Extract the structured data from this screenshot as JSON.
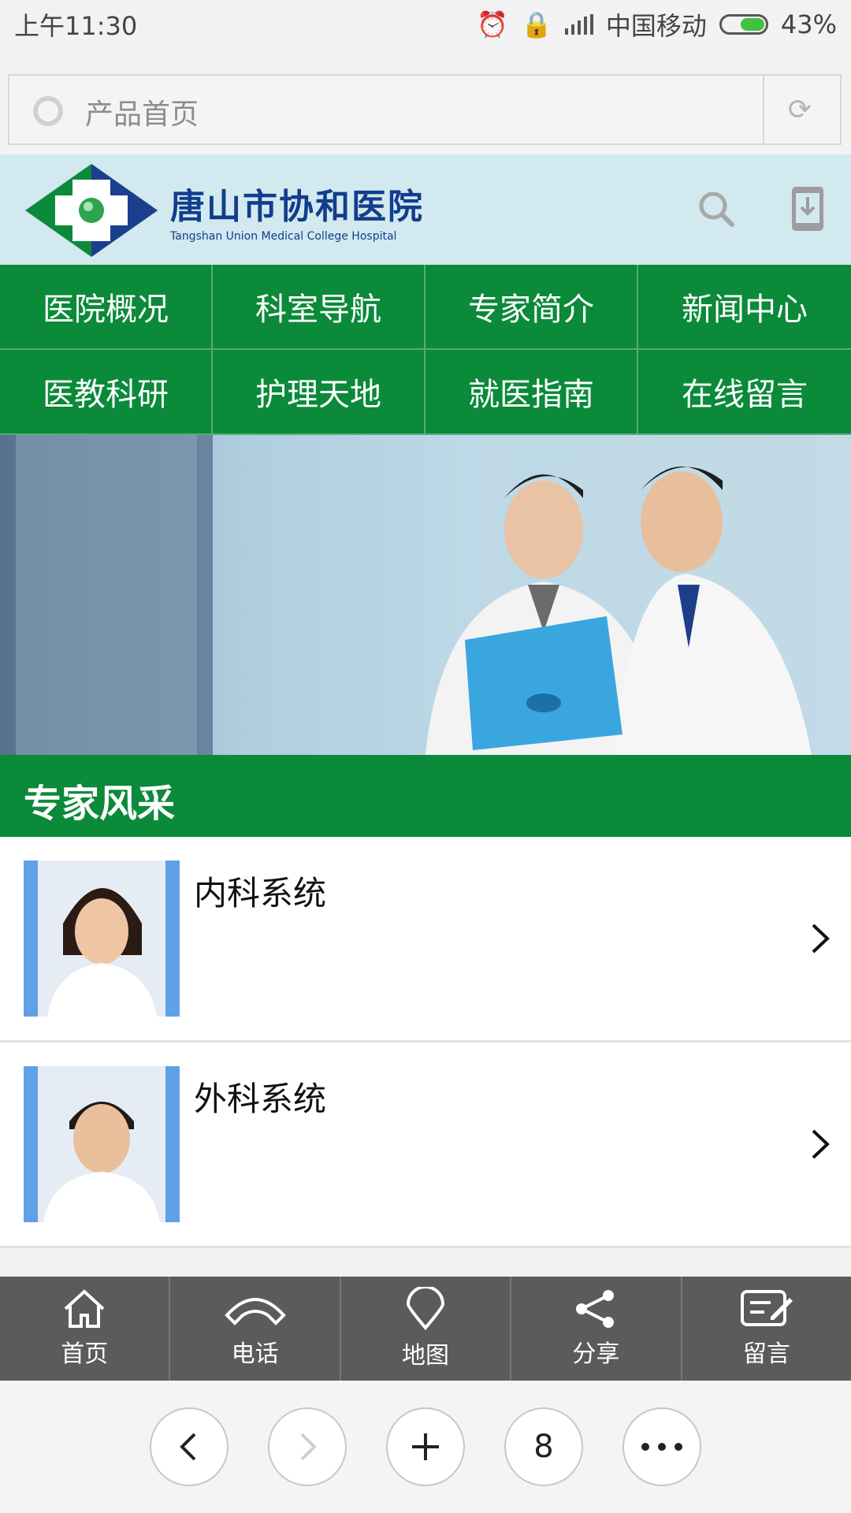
{
  "status": {
    "time": "上午11:30",
    "carrier": "中国移动",
    "battery": "43%"
  },
  "browser": {
    "url_text": "产品首页",
    "tab_count": "8"
  },
  "site": {
    "logo_cn": "唐山市协和医院",
    "logo_en": "Tangshan Union Medical College Hospital",
    "nav": [
      "医院概况",
      "科室导航",
      "专家简介",
      "新闻中心",
      "医教科研",
      "护理天地",
      "就医指南",
      "在线留言"
    ]
  },
  "section": {
    "title": "专家风采"
  },
  "list": [
    {
      "name": "内科系统"
    },
    {
      "name": "外科系统"
    }
  ],
  "tabbar": [
    "首页",
    "电话",
    "地图",
    "分享",
    "留言"
  ],
  "colors": {
    "brand_green": "#0b8a3a",
    "header_bg": "#d2e9ef",
    "tabbar_bg": "#5b5b5b"
  }
}
